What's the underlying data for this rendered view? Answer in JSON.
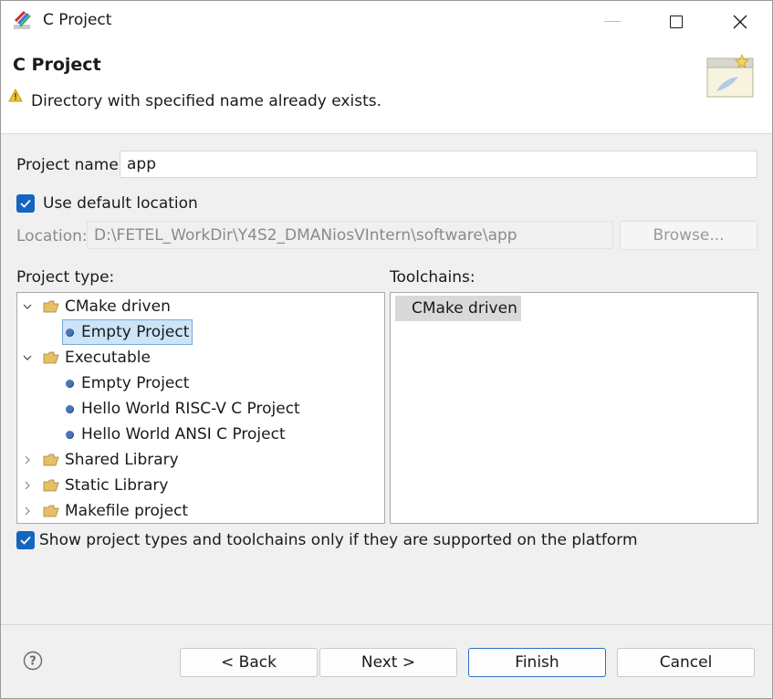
{
  "window": {
    "title": "C Project"
  },
  "banner": {
    "title": "C Project",
    "message": "Directory with specified name already exists."
  },
  "form": {
    "project_name_label": "Project name:",
    "project_name_value": "app",
    "use_default_location_label": "Use default location",
    "use_default_location_checked": true,
    "location_label": "Location:",
    "location_value": "D:\\FETEL_WorkDir\\Y4S2_DMANiosVIntern\\software\\app",
    "browse_label": "Browse...",
    "project_type_label": "Project type:",
    "toolchains_label": "Toolchains:",
    "show_supported_label": "Show project types and toolchains only if they are supported on the platform",
    "show_supported_checked": true
  },
  "project_types": [
    {
      "label": "CMake driven",
      "expanded": true,
      "children": [
        {
          "label": "Empty Project",
          "selected": true
        }
      ]
    },
    {
      "label": "Executable",
      "expanded": true,
      "children": [
        {
          "label": "Empty Project"
        },
        {
          "label": "Hello World RISC-V C Project"
        },
        {
          "label": "Hello World ANSI C Project"
        }
      ]
    },
    {
      "label": "Shared Library",
      "expanded": false,
      "children": []
    },
    {
      "label": "Static Library",
      "expanded": false,
      "children": []
    },
    {
      "label": "Makefile project",
      "expanded": false,
      "children": []
    }
  ],
  "toolchains": [
    {
      "label": "CMake driven",
      "selected": true
    }
  ],
  "buttons": {
    "back": "< Back",
    "next": "Next >",
    "finish": "Finish",
    "cancel": "Cancel"
  },
  "icons": {
    "app": "eclipse-c-project-icon",
    "warning": "warning-icon",
    "wizard": "new-project-wizard-icon",
    "help": "help-icon",
    "folder": "folder-icon",
    "leaf": "project-template-icon"
  },
  "colors": {
    "accent": "#1565c0",
    "selection": "#cce4f7",
    "toolchain_selection": "#d9d9d9"
  }
}
